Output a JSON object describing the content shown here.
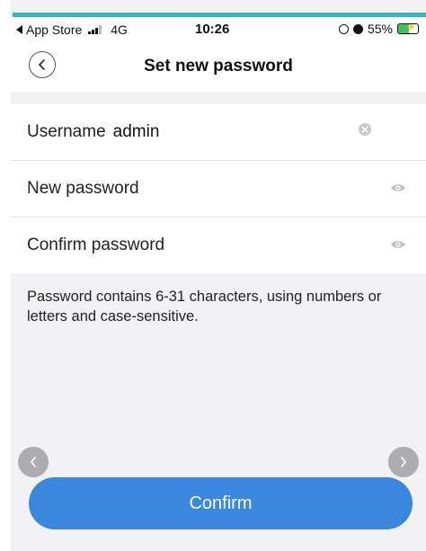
{
  "status_bar": {
    "back_app": "App Store",
    "network": "4G",
    "time": "10:26",
    "battery_percent": "55%",
    "battery_level": 0.55,
    "battery_color": "#34c759"
  },
  "nav": {
    "title": "Set new password",
    "back_icon": "chevron-left-icon"
  },
  "form": {
    "username": {
      "label": "Username",
      "value": "admin",
      "trailing_icon": "clear-icon"
    },
    "new_password": {
      "label": "New password",
      "value": "",
      "trailing_icon": "eye-icon"
    },
    "confirm_password": {
      "label": "Confirm password",
      "value": "",
      "trailing_icon": "eye-icon"
    }
  },
  "hint": "Password contains 6-31 characters, using numbers or letters and case-sensitive.",
  "carousel": {
    "prev_icon": "chevron-left-icon",
    "next_icon": "chevron-right-icon"
  },
  "confirm_button": {
    "label": "Confirm",
    "color": "#3a87e0"
  },
  "colors": {
    "accent_line": "#33b6c4",
    "background": "#f2f2f4"
  }
}
